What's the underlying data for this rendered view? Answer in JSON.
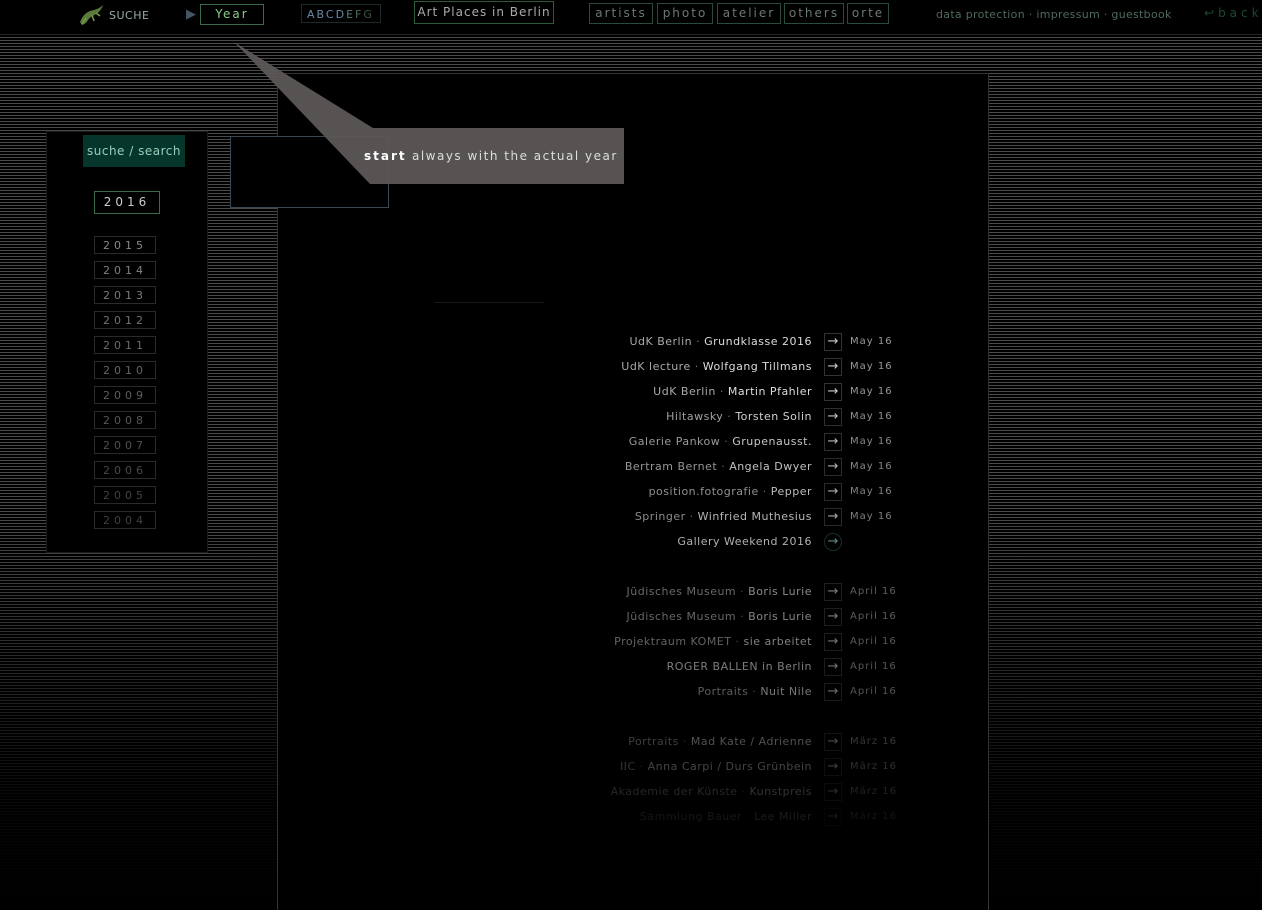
{
  "topbar": {
    "suche_label": "SUCHE",
    "year_label": "Year",
    "alphabet": [
      "A",
      "B",
      "C",
      "D",
      "E",
      "F",
      "G"
    ],
    "art_places_label": "Art Places in Berlin",
    "nav": [
      "artists",
      "photo",
      "atelier",
      "others",
      "orte"
    ],
    "links": [
      "data protection",
      "impressum",
      "guestbook"
    ],
    "link_separator": "·",
    "back_label": "back"
  },
  "sidebar": {
    "search_label": "suche / search",
    "current_year": "2016",
    "years": [
      "2015",
      "2014",
      "2013",
      "2012",
      "2011",
      "2010",
      "2009",
      "2008",
      "2007",
      "2006",
      "2005",
      "2004"
    ]
  },
  "callout": {
    "bold": "start",
    "text": "always with the actual year"
  },
  "entries": [
    {
      "venue": "UdK Berlin",
      "title": "Grundklasse 2016",
      "date": "May 16",
      "round": false
    },
    {
      "venue": "UdK lecture",
      "title": "Wolfgang Tillmans",
      "date": "May 16",
      "round": false
    },
    {
      "venue": "UdK Berlin",
      "title": "Martin Pfahler",
      "date": "May 16",
      "round": false
    },
    {
      "venue": "Hiltawsky",
      "title": "Torsten Solin",
      "date": "May 16",
      "round": false
    },
    {
      "venue": "Galerie Pankow",
      "title": "Grupenausst.",
      "date": "May 16",
      "round": false
    },
    {
      "venue": "Bertram Bernet",
      "title": "Angela Dwyer",
      "date": "May 16",
      "round": false
    },
    {
      "venue": "position.fotografie",
      "title": "Pepper",
      "date": "May 16",
      "round": false
    },
    {
      "venue": "Springer",
      "title": "Winfried Muthesius",
      "date": "May 16",
      "round": false
    },
    {
      "venue": "",
      "title": "Gallery Weekend 2016",
      "date": "",
      "round": true
    },
    {
      "venue": "Jüdisches Museum",
      "title": "Boris Lurie",
      "date": "April 16",
      "round": false
    },
    {
      "venue": "Jüdisches Museum",
      "title": "Boris Lurie",
      "date": "April 16",
      "round": false
    },
    {
      "venue": "Projektraum KOMET",
      "title": "sie arbeitet",
      "date": "April 16",
      "round": false
    },
    {
      "venue": "",
      "title": "ROGER BALLEN in Berlin",
      "date": "April 16",
      "round": false
    },
    {
      "venue": "Portraits",
      "title": "Nuit Nile",
      "date": "April 16",
      "round": false
    },
    {
      "venue": "Portraits",
      "title": "Mad Kate / Adrienne",
      "date": "März 16",
      "round": false
    },
    {
      "venue": "IIC",
      "title": "Anna Carpi / Durs Grünbein",
      "date": "März 16",
      "round": false
    },
    {
      "venue": "Akademie der Künste",
      "title": "Kunstpreis",
      "date": "März 16",
      "round": false
    },
    {
      "venue": "Sammlung Bauer",
      "title": "Lee Miller",
      "date": "März 16",
      "round": false
    }
  ],
  "separator": "·",
  "arrow_glyph": "→",
  "back_glyph": "↩"
}
